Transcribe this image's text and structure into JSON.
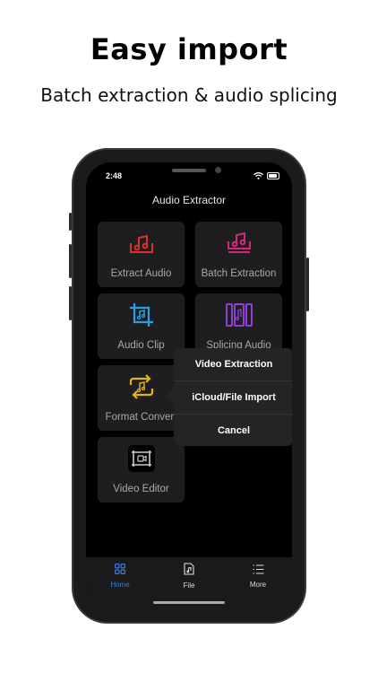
{
  "headline": "Easy import",
  "subline": "Batch extraction & audio splicing",
  "status": {
    "time": "2:48"
  },
  "app": {
    "title": "Audio Extractor"
  },
  "tools": [
    {
      "label": "Extract Audio",
      "icon": "music-tray-icon",
      "color": "#d9312b"
    },
    {
      "label": "Batch Extraction",
      "icon": "music-tray-stack-icon",
      "color": "#d6287b"
    },
    {
      "label": "Audio Clip",
      "icon": "crop-music-icon",
      "color": "#2a9fe3"
    },
    {
      "label": "Splicing Audio",
      "icon": "splice-music-icon",
      "color": "#8e3fd6"
    },
    {
      "label": "Format Convert",
      "icon": "convert-music-icon",
      "color": "#e0b319"
    },
    {
      "label": "Video Editor",
      "icon": "video-frame-icon",
      "color": "#cccccc"
    }
  ],
  "popup": {
    "items": [
      "Video Extraction",
      "iCloud/File Import",
      "Cancel"
    ]
  },
  "tabbar": {
    "active_color": "#3d7be0",
    "inactive_color": "#dddddd",
    "tabs": [
      {
        "label": "Home",
        "icon": "grid-icon"
      },
      {
        "label": "File",
        "icon": "file-music-icon"
      },
      {
        "label": "More",
        "icon": "list-icon"
      }
    ]
  }
}
